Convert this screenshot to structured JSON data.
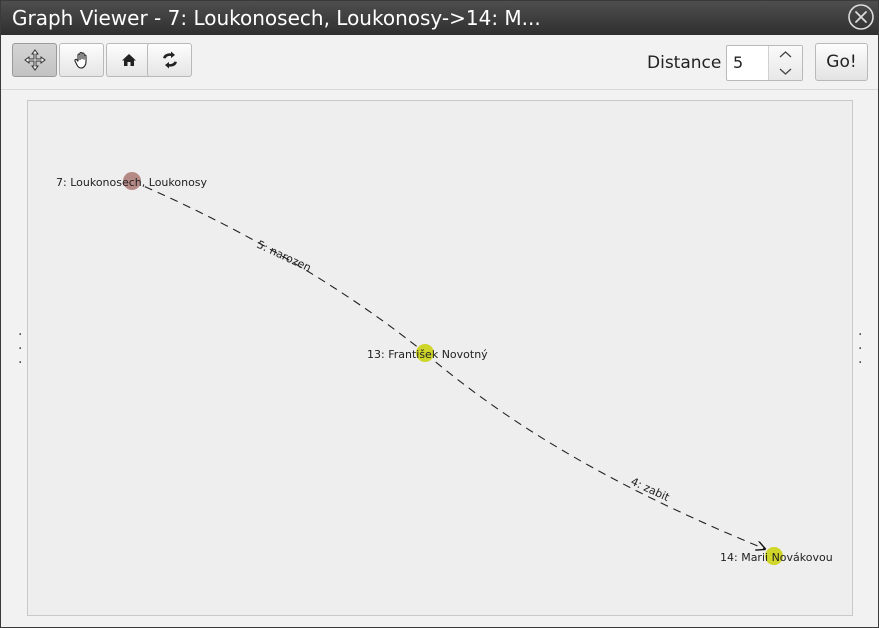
{
  "window": {
    "title": "Graph Viewer - 7: Loukonosech, Loukonosy->14: M..."
  },
  "toolbar": {
    "tools": [
      {
        "name": "move-tool",
        "icon": "move-arrows-icon",
        "active": true
      },
      {
        "name": "pan-tool",
        "icon": "hand-icon",
        "active": false
      },
      {
        "name": "home-tool",
        "icon": "home-icon",
        "active": false
      },
      {
        "name": "refresh-tool",
        "icon": "refresh-icon",
        "active": false
      }
    ],
    "distance_label": "Distance",
    "distance_value": "5",
    "go_label": "Go!"
  },
  "graph": {
    "nodes": [
      {
        "id": "7",
        "label": "7: Loukonosech, Loukonosy",
        "color": "#b58a86"
      },
      {
        "id": "13",
        "label": "13: František Novotný",
        "color": "#cfd629"
      },
      {
        "id": "14",
        "label": "14: Marii Novákovou",
        "color": "#cfd629"
      }
    ],
    "edges": [
      {
        "from": "7",
        "to": "13",
        "label": "5: narozen"
      },
      {
        "from": "13",
        "to": "14",
        "label": "4: zabit"
      }
    ]
  },
  "colors": {
    "titlebar": "#3a3a3a",
    "canvas": "#eeeeee"
  }
}
